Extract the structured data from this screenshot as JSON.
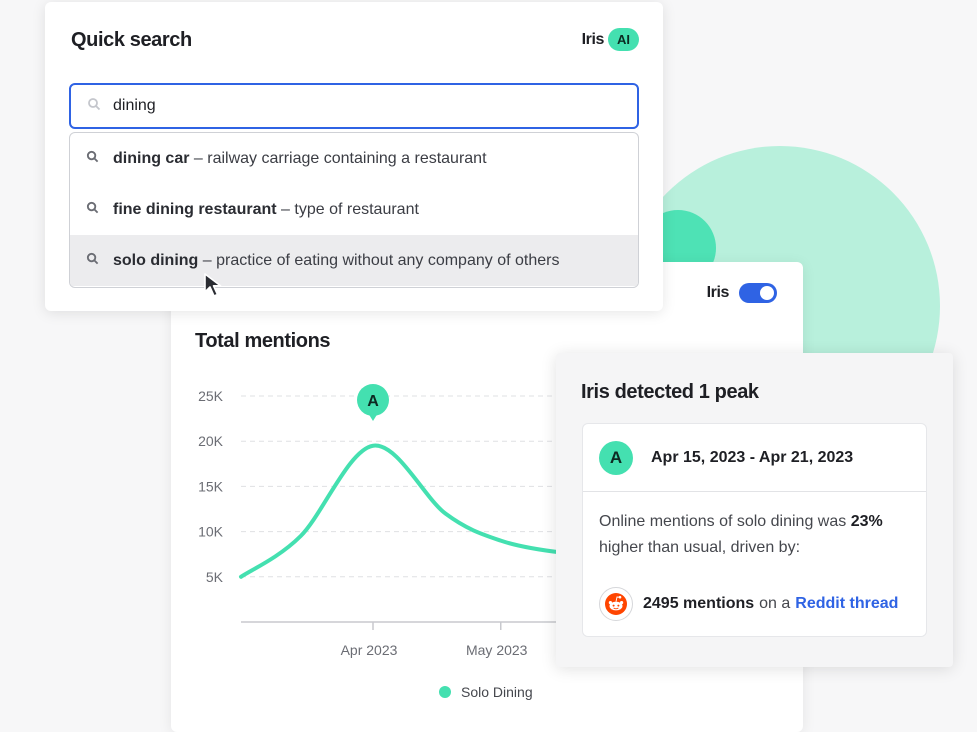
{
  "quick_search": {
    "title": "Quick search",
    "assistant_label": "Iris",
    "ai_badge": "AI",
    "query": "dining",
    "suggestions": [
      {
        "term": "dining car",
        "separator": "–",
        "description": "railway carriage containing a restaurant",
        "highlighted": false
      },
      {
        "term": "fine dining restaurant",
        "separator": "–",
        "description": "type of restaurant",
        "highlighted": false
      },
      {
        "term": "solo dining",
        "separator": "–",
        "description": "practice of eating without any company of others",
        "highlighted": true
      }
    ]
  },
  "chart_panel": {
    "iris_label": "Iris",
    "iris_toggle_on": true,
    "peak_marker": "A"
  },
  "chart_data": {
    "type": "line",
    "title": "Total mentions",
    "y_ticks": [
      "25K",
      "20K",
      "15K",
      "10K",
      "5K"
    ],
    "ylim": [
      0,
      25000
    ],
    "x_ticks": [
      "Apr 2023",
      "May 2023"
    ],
    "grid": true,
    "legend_position": "bottom",
    "series": [
      {
        "name": "Solo Dining",
        "color": "#44e0b0",
        "x": [
          "2023-03-01",
          "2023-03-15",
          "2023-04-01",
          "2023-04-18",
          "2023-05-01",
          "2023-05-15",
          "2023-05-22"
        ],
        "values": [
          5000,
          9500,
          19500,
          12000,
          9000,
          7700,
          7800
        ]
      }
    ]
  },
  "peak_panel": {
    "title": "Iris detected 1 peak",
    "badge": "A",
    "date_range": "Apr 15, 2023 - Apr 21, 2023",
    "desc_prefix": "Online mentions of solo dining was",
    "desc_pct": "23%",
    "desc_suffix": "higher than usual, driven by:",
    "mentions": "2495 mentions",
    "mentions_joiner": "on a",
    "source_link": "Reddit thread",
    "source_icon": "reddit-icon"
  }
}
